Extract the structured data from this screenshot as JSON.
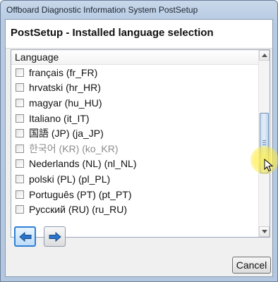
{
  "window": {
    "title": "Offboard Diagnostic Information System PostSetup"
  },
  "page": {
    "heading": "PostSetup - Installed language selection"
  },
  "language_list": {
    "column_header": "Language",
    "rows": [
      {
        "label": "français  (fr_FR)",
        "checked": false,
        "dim": false
      },
      {
        "label": "hrvatski  (hr_HR)",
        "checked": false,
        "dim": false
      },
      {
        "label": "magyar  (hu_HU)",
        "checked": false,
        "dim": false
      },
      {
        "label": "Italiano  (it_IT)",
        "checked": false,
        "dim": false
      },
      {
        "label": "国語 (JP)  (ja_JP)",
        "checked": false,
        "dim": false
      },
      {
        "label": "한국어 (KR)  (ko_KR)",
        "checked": false,
        "dim": true
      },
      {
        "label": "Nederlands (NL)  (nl_NL)",
        "checked": false,
        "dim": false
      },
      {
        "label": "polski (PL)  (pl_PL)",
        "checked": false,
        "dim": false
      },
      {
        "label": "Português (PT)  (pt_PT)",
        "checked": false,
        "dim": false
      },
      {
        "label": "Русский (RU)  (ru_RU)",
        "checked": false,
        "dim": false
      }
    ],
    "scroll_up_icon": "triangle-up",
    "scroll_down_icon": "triangle-down"
  },
  "navigation": {
    "back_icon": "arrow-left-icon",
    "forward_icon": "arrow-right-icon"
  },
  "buttons": {
    "cancel_label": "Cancel"
  },
  "colors": {
    "nav_arrow": "#2c73c9",
    "active_border": "#2f7fd4",
    "cursor_highlight": "#ffeb3c"
  }
}
